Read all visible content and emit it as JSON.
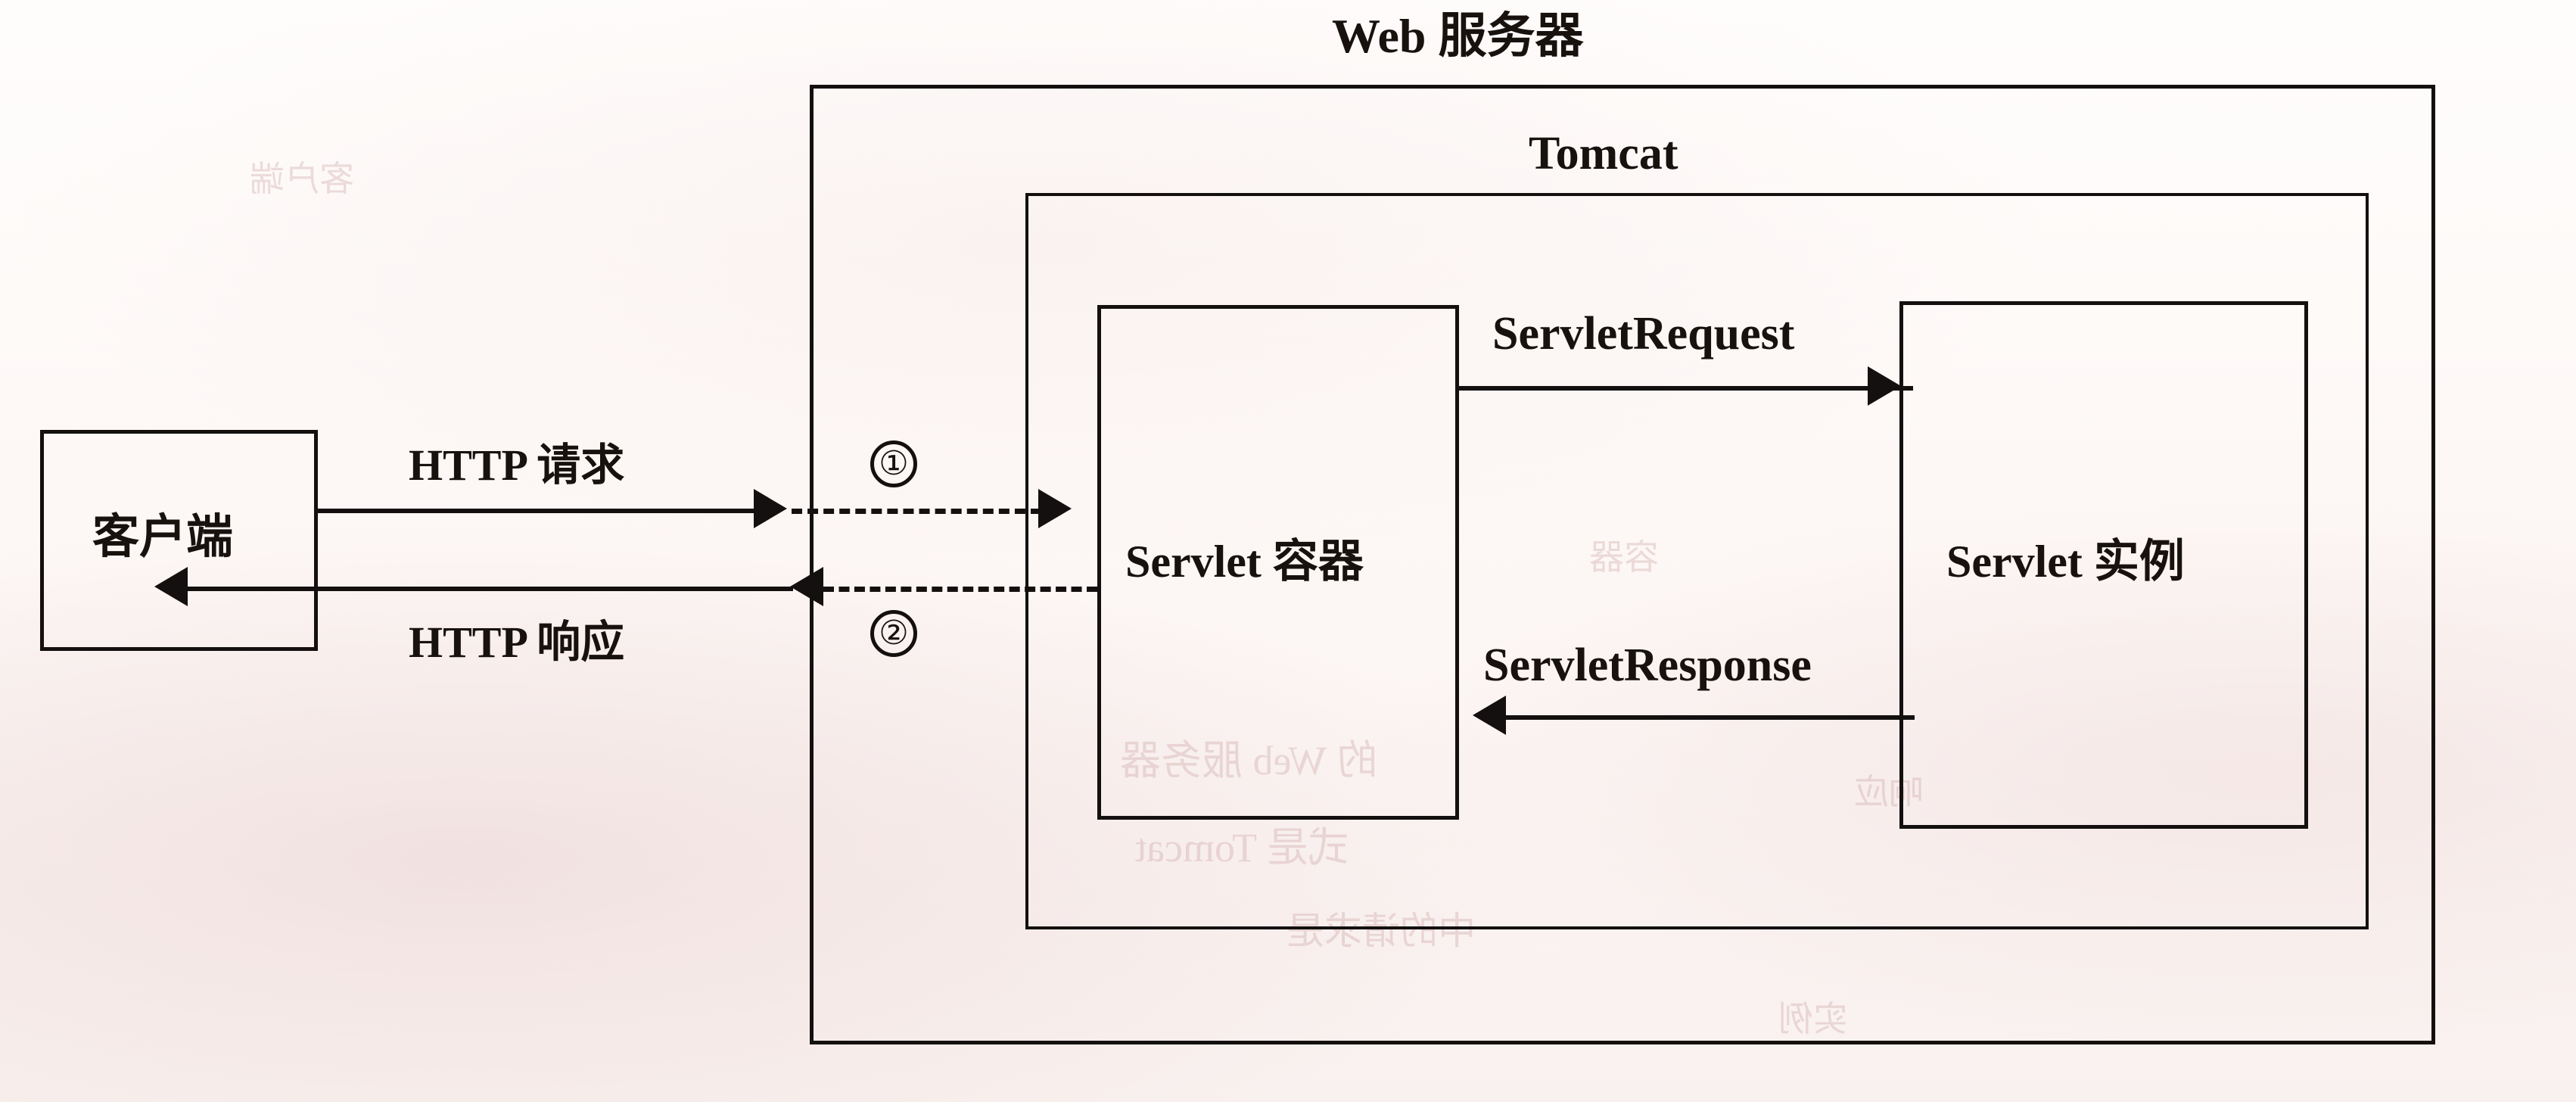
{
  "diagram": {
    "title_outer": "Web 服务器",
    "title_tomcat": "Tomcat",
    "boxes": {
      "client": "客户端",
      "servlet_container": "Servlet 容器",
      "servlet_instance": "Servlet 实例"
    },
    "flows": {
      "http_request": "HTTP 请求",
      "http_response": "HTTP 响应",
      "servlet_request": "ServletRequest",
      "servlet_response": "ServletResponse"
    },
    "steps": {
      "one": "①",
      "two": "②"
    },
    "colors": {
      "ink": "#141010",
      "paper": "#fdfbfa",
      "bleed": "#c49696"
    },
    "bleed_through": {
      "a": "的 Web 服务器",
      "b": "式是 Tomcat",
      "c": "中的请求是",
      "d": "容器",
      "e": "客户端",
      "f": "响应",
      "g": "实例"
    }
  }
}
